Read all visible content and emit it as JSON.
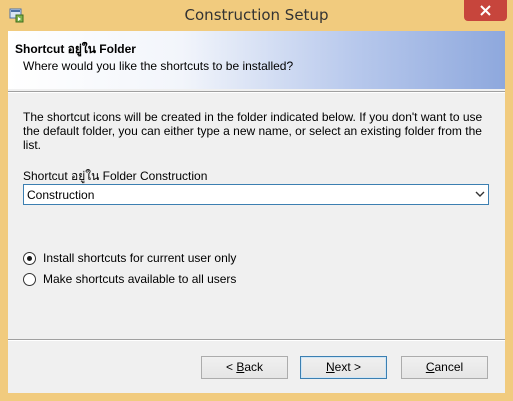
{
  "window": {
    "title": "Construction Setup",
    "accent_color": "#f1cb7e",
    "close_color": "#c7453c",
    "icon": "installer-app-icon"
  },
  "banner": {
    "title": "Shortcut อยู่ใน Folder",
    "subtitle": "Where would you like the shortcuts to be installed?"
  },
  "body": {
    "description": "The shortcut icons will be created in the folder indicated below. If you don't want to use the default folder, you can either type a new name, or select an existing folder from the list.",
    "folder_label": "Shortcut อยู่ใน Folder Construction",
    "folder_value": "Construction"
  },
  "options": [
    {
      "label": "Install shortcuts for current user only",
      "checked": true
    },
    {
      "label": "Make shortcuts available to all users",
      "checked": false
    }
  ],
  "buttons": {
    "back": {
      "prefix": "< ",
      "mnemonic": "B",
      "rest": "ack"
    },
    "next": {
      "mnemonic": "N",
      "rest": "ext >"
    },
    "cancel": {
      "mnemonic": "C",
      "rest": "ancel"
    }
  }
}
